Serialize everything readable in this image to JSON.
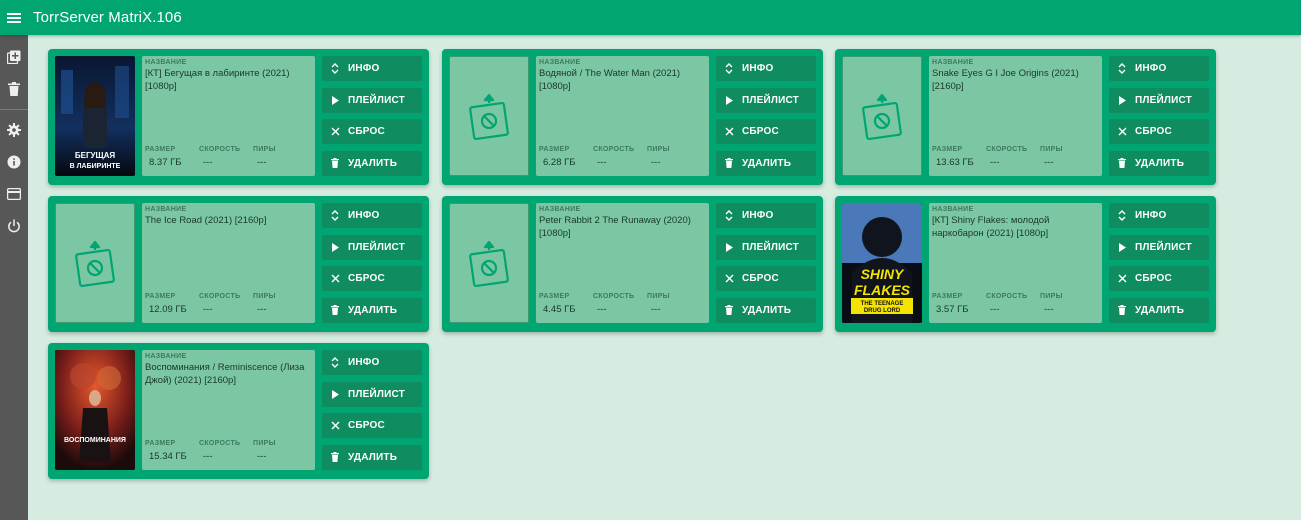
{
  "app": {
    "title": "TorrServer MatriX.106"
  },
  "labels": {
    "name": "НАЗВАНИЕ",
    "size": "РАЗМЕР",
    "speed": "СКОРОСТЬ",
    "peers": "ПИРЫ"
  },
  "actions": {
    "info": "ИНФО",
    "playlist": "ПЛЕЙЛИСТ",
    "reset": "СБРОС",
    "delete": "УДАЛИТЬ"
  },
  "sidebar": {
    "items": [
      "add-icon",
      "delete-icon",
      "settings-icon",
      "info-icon",
      "card-icon",
      "power-icon"
    ]
  },
  "torrents": [
    {
      "name": "[КТ] Бегущая в лабиринте (2021) [1080p]",
      "size": "8.37 ГБ",
      "speed": "---",
      "peers": "---",
      "poster": "image",
      "poster_text": "БЕГУЩАЯ В ЛАБИРИНТЕ"
    },
    {
      "name": "Водяной / The Water Man (2021) [1080p]",
      "size": "6.28 ГБ",
      "speed": "---",
      "peers": "---",
      "poster": "placeholder"
    },
    {
      "name": "Snake Eyes G I Joe Origins (2021) [2160p]",
      "size": "13.63 ГБ",
      "speed": "---",
      "peers": "---",
      "poster": "placeholder"
    },
    {
      "name": "The Ice Road (2021) [2160p]",
      "size": "12.09 ГБ",
      "speed": "---",
      "peers": "---",
      "poster": "placeholder"
    },
    {
      "name": "Peter Rabbit 2 The Runaway (2020) [1080p]",
      "size": "4.45 ГБ",
      "speed": "---",
      "peers": "---",
      "poster": "placeholder"
    },
    {
      "name": "[КТ] Shiny Flakes: молодой наркобарон (2021) [1080p]",
      "size": "3.57 ГБ",
      "speed": "---",
      "peers": "---",
      "poster": "image",
      "poster_text": "SHINY FLAKES",
      "poster_subtext": "THE TEENAGE DRUG LORD"
    },
    {
      "name": "Воспоминания / Reminiscence (Лиза Джой) (2021) [2160p]",
      "size": "15.34 ГБ",
      "speed": "---",
      "peers": "---",
      "poster": "image",
      "poster_text": "ВОСПОМИНАНИЯ"
    }
  ]
}
